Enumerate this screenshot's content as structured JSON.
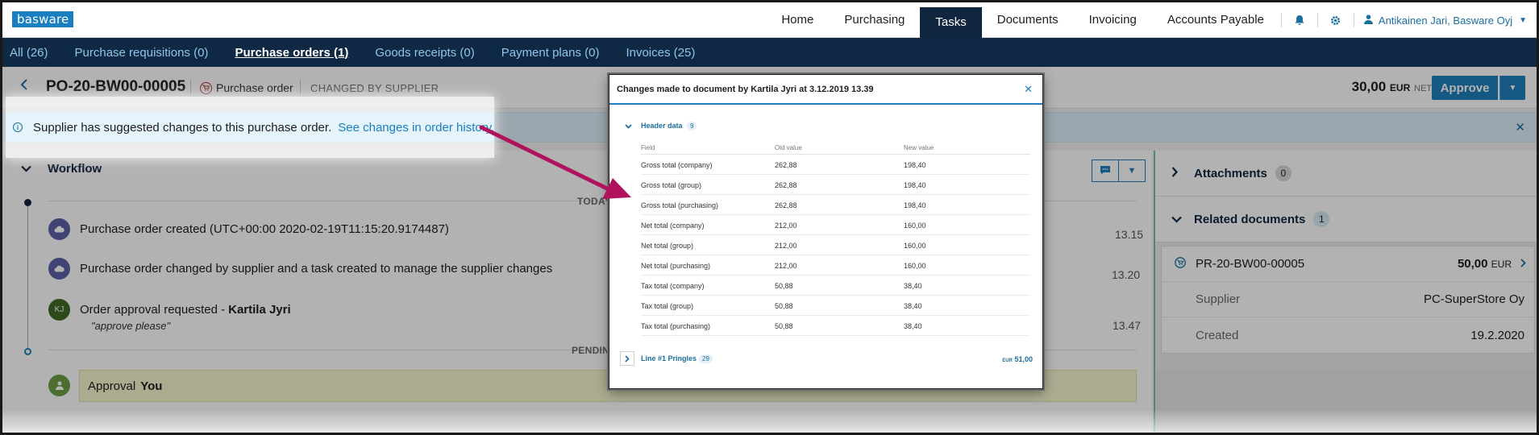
{
  "app": {
    "logo": "basware"
  },
  "topnav": {
    "items": [
      "Home",
      "Purchasing",
      "Tasks",
      "Documents",
      "Invoicing",
      "Accounts Payable"
    ],
    "active": "Tasks",
    "user": "Antikainen Jari, Basware Oyj"
  },
  "subnav": {
    "items": [
      "All (26)",
      "Purchase requisitions (0)",
      "Purchase orders (1)",
      "Goods receipts (0)",
      "Payment plans (0)",
      "Invoices (25)"
    ],
    "active": "Purchase orders (1)"
  },
  "doc": {
    "id": "PO-20-BW00-00005",
    "type": "Purchase order",
    "status": "CHANGED BY SUPPLIER",
    "amount": "30,00",
    "currency": "EUR",
    "net": "NET",
    "approve_label": "Approve"
  },
  "banner": {
    "text": "Supplier has suggested changes to this purchase order.",
    "link": "See changes in order history."
  },
  "workflow": {
    "title": "Workflow",
    "today_label": "TODAY",
    "pending_label": "PENDING",
    "events": [
      {
        "avatar": "",
        "text": "Purchase order created (UTC+00:00 2020-02-19T11:15:20.9174487)",
        "time": "13.15"
      },
      {
        "avatar": "",
        "text": "Purchase order changed by supplier and a task created to manage the supplier changes",
        "time": "13.20"
      },
      {
        "avatar": "KJ",
        "text": "Order approval requested - ",
        "strong": "Kartila Jyri",
        "note": "\"approve please\"",
        "time": "13.47"
      }
    ],
    "pending": {
      "text": "Approval",
      "strong": "You"
    }
  },
  "right_panel": {
    "attachments": {
      "title": "Attachments",
      "count": "0"
    },
    "related": {
      "title": "Related documents",
      "count": "1",
      "doc_no": "PR-20-BW00-00005",
      "amount": "50,00",
      "currency": "EUR",
      "supplier_label": "Supplier",
      "supplier": "PC-SuperStore Oy",
      "created_label": "Created",
      "created": "19.2.2020"
    }
  },
  "modal": {
    "title": "Changes made to document by Kartila Jyri at 3.12.2019 13.39",
    "section": "Header data",
    "section_count": "9",
    "columns": [
      "Field",
      "Old value",
      "New value"
    ],
    "rows": [
      [
        "Gross total (company)",
        "262,88",
        "198,40"
      ],
      [
        "Gross total (group)",
        "262,88",
        "198,40"
      ],
      [
        "Gross total (purchasing)",
        "262,88",
        "198,40"
      ],
      [
        "Net total (company)",
        "212,00",
        "160,00"
      ],
      [
        "Net total (group)",
        "212,00",
        "160,00"
      ],
      [
        "Net total (purchasing)",
        "212,00",
        "160,00"
      ],
      [
        "Tax total (company)",
        "50,88",
        "38,40"
      ],
      [
        "Tax total (group)",
        "50,88",
        "38,40"
      ],
      [
        "Tax total (purchasing)",
        "50,88",
        "38,40"
      ]
    ],
    "line_label": "Line #1  Pringles",
    "line_count": "29",
    "line_currency": "EUR",
    "line_total": "51,00"
  },
  "colors": {
    "accent": "#1f7ebb",
    "navy": "#0f2944",
    "arrow": "#b0135c"
  }
}
